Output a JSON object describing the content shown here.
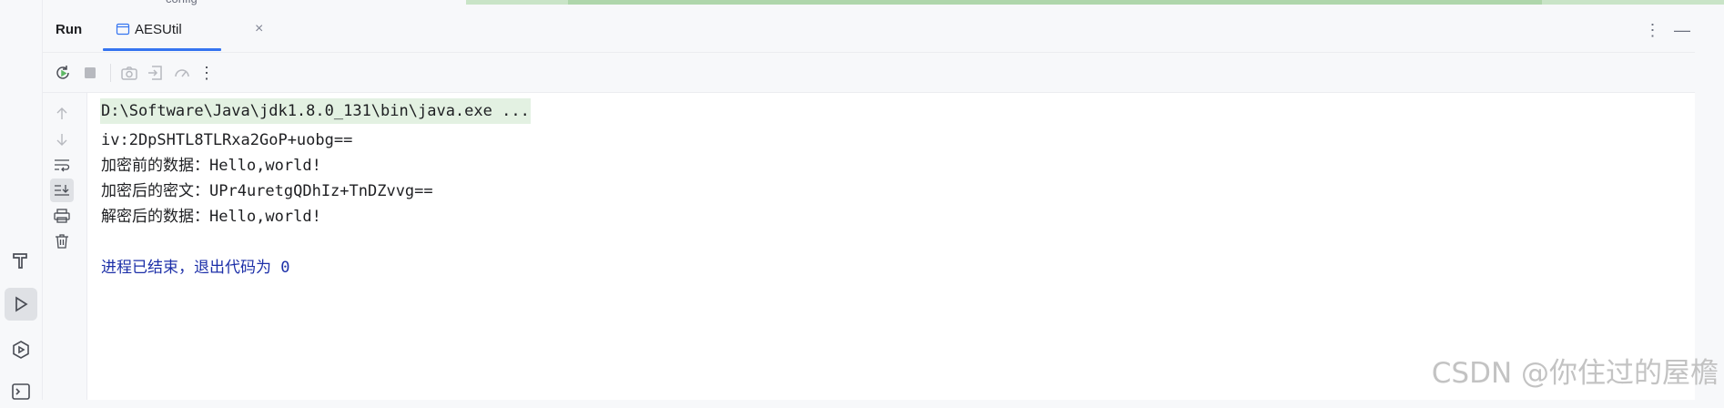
{
  "editor_breadcrumb": "config",
  "run_panel": {
    "title": "Run",
    "tab": {
      "label": "AESUtil",
      "icon": "java-class-file-icon"
    },
    "header_icons": [
      "more-options-icon",
      "minimize-icon"
    ]
  },
  "toolbar": {
    "icons": [
      "rerun-icon",
      "stop-icon",
      "camera-icon",
      "restore-layout-icon",
      "coverage-icon",
      "more-options-icon"
    ]
  },
  "gutter": {
    "icons": [
      "arrow-up-icon",
      "arrow-down-icon",
      "soft-wrap-icon",
      "scroll-to-end-icon",
      "print-icon",
      "delete-icon"
    ]
  },
  "console": {
    "command": "D:\\Software\\Java\\jdk1.8.0_131\\bin\\java.exe ...",
    "lines": [
      "iv:2DpSHTL8TLRxa2GoP+uobg==",
      "加密前的数据：Hello,world!",
      "加密后的密文：UPr4uretgQDhIz+TnDZvvg==",
      "解密后的数据：Hello,world!"
    ],
    "exit_message": "进程已结束，退出代码为 0"
  },
  "left_strip": {
    "icons": [
      "build-hammer-icon",
      "run-icon",
      "services-icon",
      "terminal-icon"
    ]
  },
  "watermark": "CSDN @你住过的屋檐",
  "colors": {
    "accent": "#3574f0",
    "command_highlight": "#e3f1e2",
    "exit_text": "#1c2fa8",
    "panel_bg": "#f7f8fa"
  }
}
